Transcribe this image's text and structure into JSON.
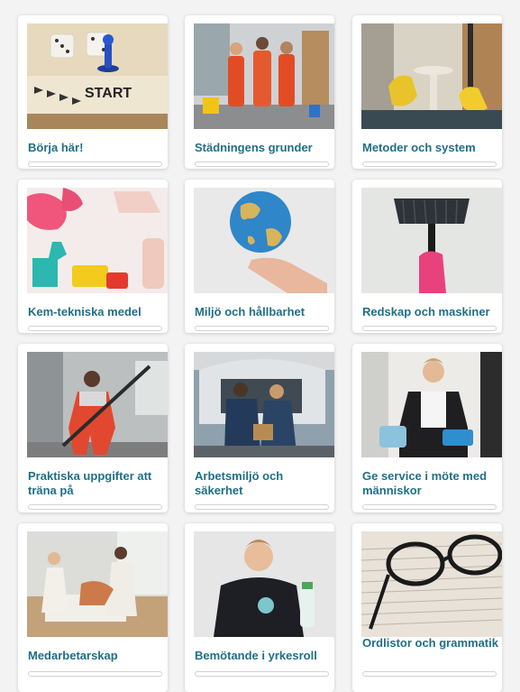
{
  "courses": [
    {
      "title": "Börja här!",
      "image": "board-game-start-image",
      "progress": 0
    },
    {
      "title": "Städningens grunder",
      "image": "cleaning-team-image",
      "progress": 0
    },
    {
      "title": "Metoder och system",
      "image": "gloved-hands-lamp-image",
      "progress": 0
    },
    {
      "title": "Kem-tekniska medel",
      "image": "cleaning-supplies-image",
      "progress": 0
    },
    {
      "title": "Miljö och hållbarhet",
      "image": "globe-in-hand-image",
      "progress": 0
    },
    {
      "title": "Redskap och maskiner",
      "image": "broom-image",
      "progress": 0
    },
    {
      "title": "Praktiska uppgifter att träna på",
      "image": "vacuum-guitar-image",
      "progress": 0
    },
    {
      "title": "Arbetsmiljö och säkerhet",
      "image": "car-trunk-workers-image",
      "progress": 0
    },
    {
      "title": "Ge service i möte med människor",
      "image": "service-worker-image",
      "progress": 0
    },
    {
      "title": "Medarbetarskap",
      "image": "hotel-room-staff-image",
      "progress": 0
    },
    {
      "title": "Bemötande i yrkesroll",
      "image": "smiling-cleaner-image",
      "progress": 0
    },
    {
      "title": "Ordlistor och grammatik",
      "image": "glasses-on-book-image",
      "progress": 0
    }
  ],
  "colors": {
    "title": "#1f6f86",
    "progress_track": "#d2d2d2",
    "background": "#f3f3f3"
  }
}
